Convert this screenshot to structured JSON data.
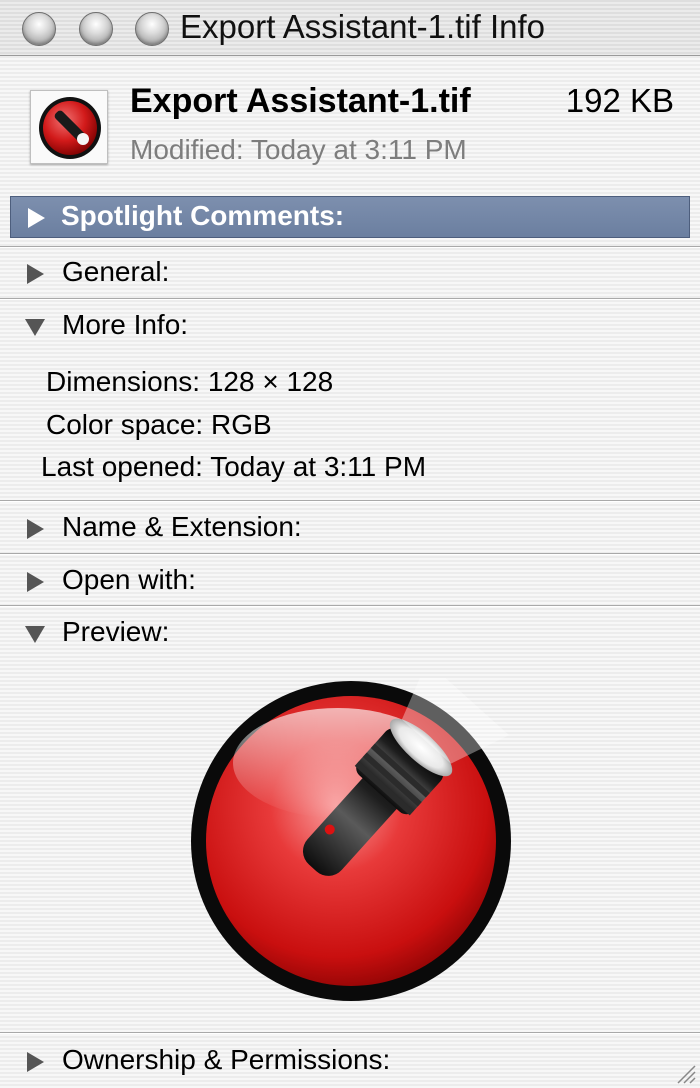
{
  "window": {
    "title": "Export Assistant-1.tif Info",
    "buttons": [
      "close",
      "minimize",
      "zoom"
    ]
  },
  "file": {
    "name": "Export Assistant-1.tif",
    "size": "192 KB",
    "modified": "Modified: Today at 3:11 PM",
    "icon": "flashlight-icon"
  },
  "sections": {
    "spotlight": {
      "label": "Spotlight Comments:",
      "expanded": false,
      "selected": true
    },
    "general": {
      "label": "General:",
      "expanded": false
    },
    "more_info": {
      "label": "More Info:",
      "expanded": true,
      "rows": [
        {
          "key": "Dimensions:",
          "value": "128 × 128"
        },
        {
          "key": "Color space:",
          "value": "RGB"
        },
        {
          "key": "Last opened:",
          "value": "Today at 3:11 PM"
        }
      ]
    },
    "name_extension": {
      "label": "Name & Extension:",
      "expanded": false
    },
    "open_with": {
      "label": "Open with:",
      "expanded": false
    },
    "preview": {
      "label": "Preview:",
      "expanded": true,
      "image": "flashlight-icon"
    },
    "ownership": {
      "label": "Ownership & Permissions:",
      "expanded": false
    }
  },
  "colors": {
    "selected_header": "#6b7fa0",
    "icon_red": "#d91d1d"
  }
}
